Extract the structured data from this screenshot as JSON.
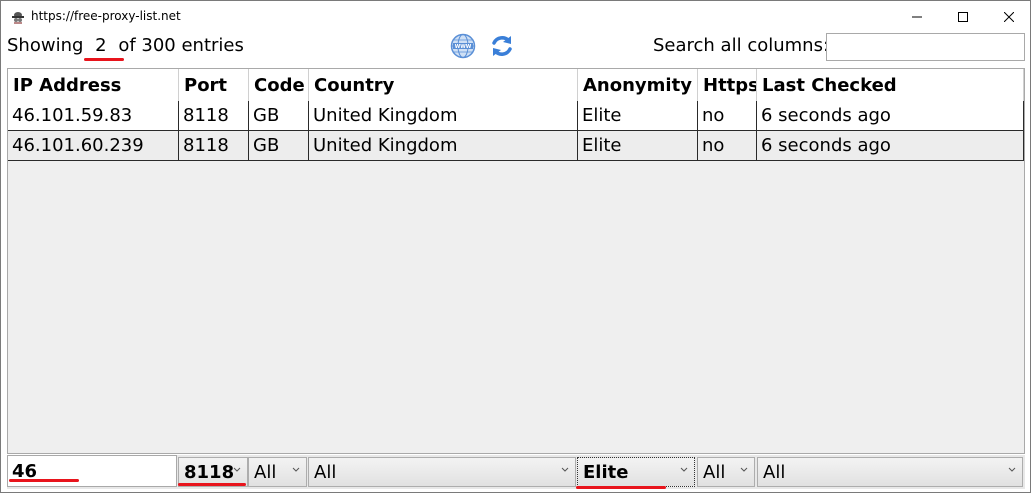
{
  "window": {
    "title": "https://free-proxy-list.net"
  },
  "toolbar": {
    "showing_prefix": "Showing",
    "showing_count": "2",
    "showing_suffix": "of 300 entries",
    "search_label": "Search all columns:",
    "search_value": "",
    "icons": [
      "www-globe-icon",
      "refresh-icon"
    ]
  },
  "table": {
    "columns": [
      "IP Address",
      "Port",
      "Code",
      "Country",
      "Anonymity",
      "Https",
      "Last Checked"
    ],
    "rows": [
      [
        "46.101.59.83",
        "8118",
        "GB",
        "United Kingdom",
        "Elite",
        "no",
        "6 seconds ago"
      ],
      [
        "46.101.60.239",
        "8118",
        "GB",
        "United Kingdom",
        "Elite",
        "no",
        "6 seconds ago"
      ]
    ]
  },
  "filters": {
    "ip_value": "46",
    "port_selected": "8118",
    "code_selected": "All",
    "country_selected": "All",
    "anonymity_selected": "Elite",
    "https_selected": "All",
    "last_checked_selected": "All"
  },
  "colors": {
    "annotation_red": "#e8141c",
    "globe_blue": "#5a8fd6",
    "refresh_blue": "#3a7fd8"
  }
}
